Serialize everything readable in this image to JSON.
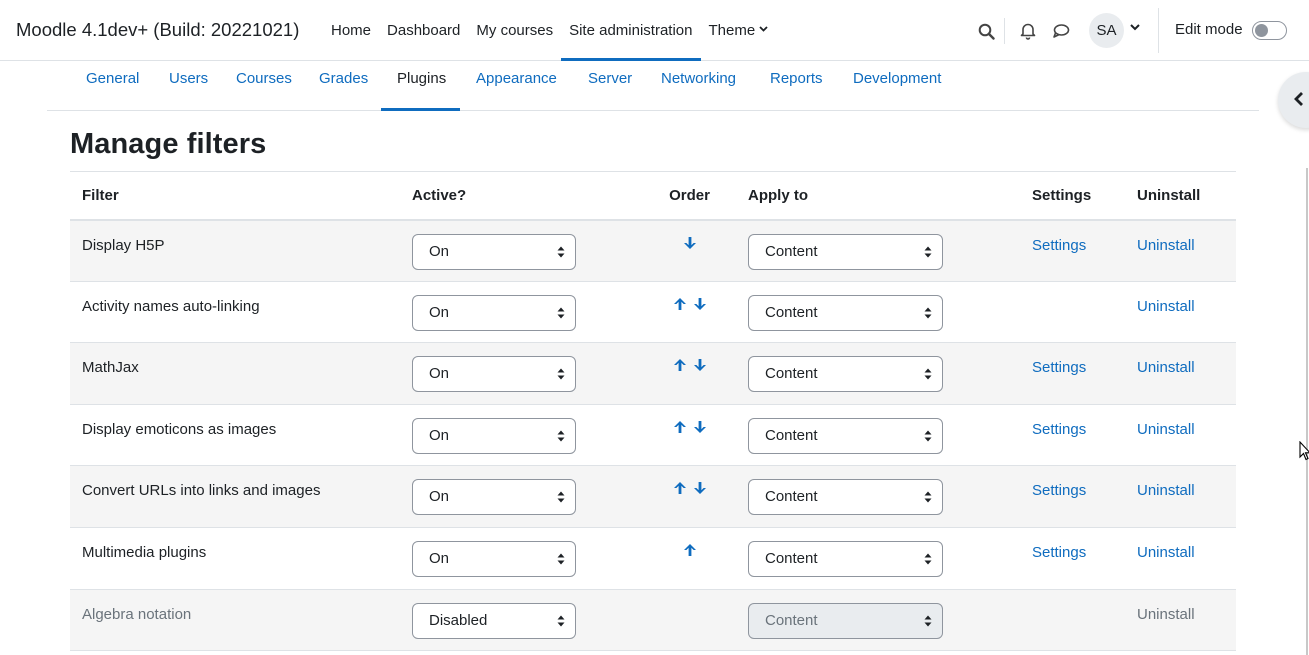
{
  "header": {
    "site_name": "Moodle 4.1dev+ (Build: 20221021)",
    "nav": [
      {
        "label": "Home"
      },
      {
        "label": "Dashboard"
      },
      {
        "label": "My courses"
      },
      {
        "label": "Site administration",
        "active": true
      },
      {
        "label": "Theme",
        "has_dropdown": true
      }
    ],
    "user_initials": "SA",
    "edit_mode_label": "Edit mode",
    "edit_mode_on": false,
    "icons": [
      "search-icon",
      "bell-icon",
      "chat-icon",
      "chevron-down-icon"
    ]
  },
  "secondary_nav": {
    "tabs": [
      {
        "label": "General"
      },
      {
        "label": "Users"
      },
      {
        "label": "Courses"
      },
      {
        "label": "Grades"
      },
      {
        "label": "Plugins",
        "active": true
      },
      {
        "label": "Appearance"
      },
      {
        "label": "Server"
      },
      {
        "label": "Networking"
      },
      {
        "label": "Reports"
      },
      {
        "label": "Development"
      }
    ]
  },
  "page": {
    "title": "Manage filters"
  },
  "table": {
    "headers": {
      "filter": "Filter",
      "active": "Active?",
      "order": "Order",
      "apply_to": "Apply to",
      "settings": "Settings",
      "uninstall": "Uninstall"
    },
    "rows": [
      {
        "name": "Display H5P",
        "active": "On",
        "up": false,
        "down": true,
        "apply_to": "Content",
        "apply_disabled": false,
        "settings": "Settings",
        "uninstall": "Uninstall",
        "dimmed": false
      },
      {
        "name": "Activity names auto-linking",
        "active": "On",
        "up": true,
        "down": true,
        "apply_to": "Content",
        "apply_disabled": false,
        "settings": "",
        "uninstall": "Uninstall",
        "dimmed": false
      },
      {
        "name": "MathJax",
        "active": "On",
        "up": true,
        "down": true,
        "apply_to": "Content",
        "apply_disabled": false,
        "settings": "Settings",
        "uninstall": "Uninstall",
        "dimmed": false
      },
      {
        "name": "Display emoticons as images",
        "active": "On",
        "up": true,
        "down": true,
        "apply_to": "Content",
        "apply_disabled": false,
        "settings": "Settings",
        "uninstall": "Uninstall",
        "dimmed": false
      },
      {
        "name": "Convert URLs into links and images",
        "active": "On",
        "up": true,
        "down": true,
        "apply_to": "Content",
        "apply_disabled": false,
        "settings": "Settings",
        "uninstall": "Uninstall",
        "dimmed": false
      },
      {
        "name": "Multimedia plugins",
        "active": "On",
        "up": true,
        "down": false,
        "apply_to": "Content",
        "apply_disabled": false,
        "settings": "Settings",
        "uninstall": "Uninstall",
        "dimmed": false
      },
      {
        "name": "Algebra notation",
        "active": "Disabled",
        "up": false,
        "down": false,
        "apply_to": "Content",
        "apply_disabled": true,
        "settings": "",
        "uninstall": "Uninstall",
        "dimmed": true
      }
    ]
  },
  "colors": {
    "link": "#0f6cbf",
    "text": "#1d2125",
    "muted": "#6a737b",
    "striped_row": "#f5f5f5",
    "border": "#dee2e6"
  }
}
